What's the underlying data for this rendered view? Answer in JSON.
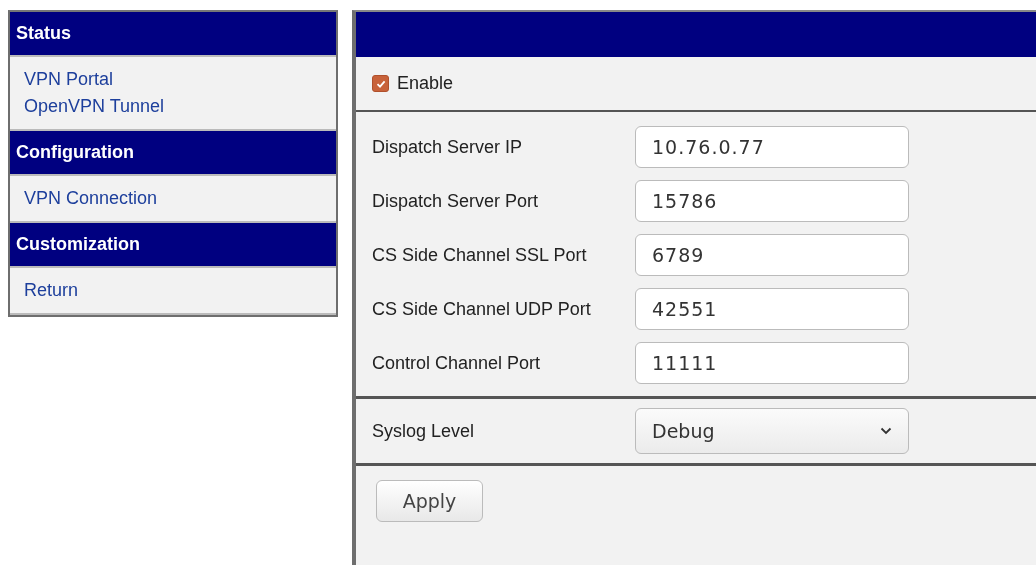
{
  "sidebar": {
    "sections": [
      {
        "title": "Status",
        "items": [
          {
            "label": "VPN Portal"
          },
          {
            "label": "OpenVPN Tunnel"
          }
        ]
      },
      {
        "title": "Configuration",
        "items": [
          {
            "label": "VPN Connection"
          }
        ]
      },
      {
        "title": "Customization",
        "items": [
          {
            "label": "Return"
          }
        ]
      }
    ]
  },
  "enable": {
    "label": "Enable",
    "checked": true
  },
  "fields": [
    {
      "label": "Dispatch Server IP",
      "value": "10.76.0.77"
    },
    {
      "label": "Dispatch Server Port",
      "value": "15786"
    },
    {
      "label": "CS Side Channel SSL Port",
      "value": "6789"
    },
    {
      "label": "CS Side Channel UDP Port",
      "value": "42551"
    },
    {
      "label": "Control Channel Port",
      "value": "11111"
    }
  ],
  "syslog": {
    "label": "Syslog Level",
    "value": "Debug"
  },
  "buttons": [
    "Apply"
  ]
}
